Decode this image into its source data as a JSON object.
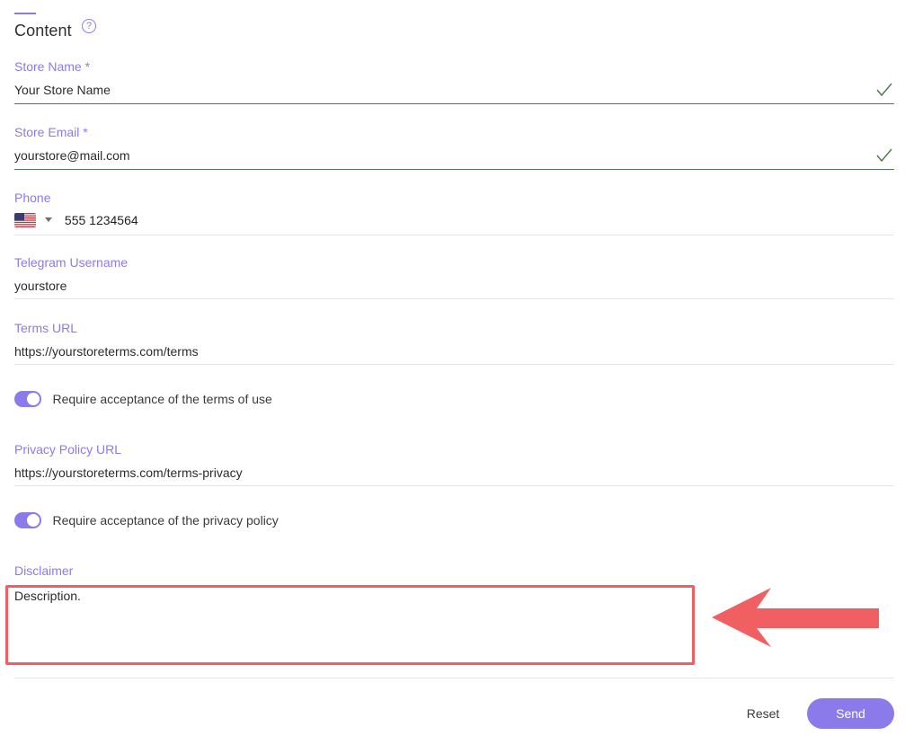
{
  "section": {
    "title": "Content",
    "help_glyph": "?",
    "help_icon": "question-circle-icon"
  },
  "fields": {
    "store_name": {
      "label": "Store Name *",
      "value": "Your Store Name",
      "valid_icon": "check-icon"
    },
    "store_email": {
      "label": "Store Email *",
      "value": "yourstore@mail.com",
      "valid_icon": "check-icon"
    },
    "phone": {
      "label": "Phone",
      "country_flag": "us-flag-icon",
      "value": "555 1234564"
    },
    "telegram": {
      "label": "Telegram Username",
      "value": "yourstore"
    },
    "terms_url": {
      "label": "Terms URL",
      "value": "https://yourstoreterms.com/terms"
    },
    "privacy_url": {
      "label": "Privacy Policy URL",
      "value": "https://yourstoreterms.com/terms-privacy"
    },
    "disclaimer": {
      "label": "Disclaimer",
      "value": "Description."
    }
  },
  "toggles": {
    "terms": {
      "label": "Require acceptance of the terms of use",
      "checked": true
    },
    "privacy": {
      "label": "Require acceptance of the privacy policy",
      "checked": true
    }
  },
  "actions": {
    "reset_label": "Reset",
    "send_label": "Send"
  },
  "colors": {
    "accent": "#8b7bea",
    "valid_line": "#4c7a4c",
    "highlight": "#f06063"
  }
}
